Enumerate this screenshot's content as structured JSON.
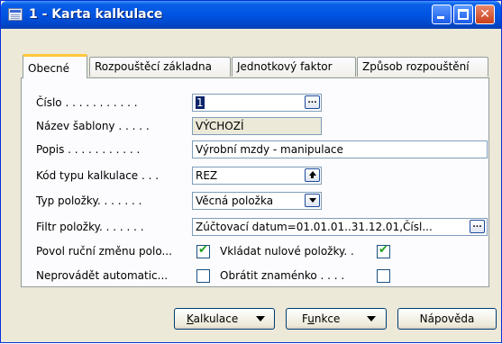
{
  "window": {
    "title": "1 - Karta kalkulace",
    "close_glyph": "✕"
  },
  "tabs": [
    "Obecné",
    "Rozpouštěcí základna",
    "Jednotkový faktor",
    "Způsob rozpouštění"
  ],
  "fields": {
    "cislo": {
      "label": "Číslo . . . . . . . . . . .",
      "value": "1"
    },
    "nazev_sablony": {
      "label": "Název šablony . . . . .",
      "value": "VÝCHOZÍ"
    },
    "popis": {
      "label": "Popis . . . . . . . . . . .",
      "value": "Výrobní mzdy - manipulace"
    },
    "kod_typu": {
      "label": "Kód typu kalkulace . . .",
      "value": "REZ"
    },
    "typ_polozky": {
      "label": "Typ položky. . . . . . .",
      "value": "Věcná položka"
    },
    "filtr_polozky": {
      "label": "Filtr položky. . . . . . .",
      "value": "Zúčtovací datum=01.01.01..31.12.01,Čísl..."
    }
  },
  "checkboxes": {
    "povol_rucni": {
      "label": "Povol ruční změnu polo...",
      "checked": true
    },
    "vkladat_nulove": {
      "label": "Vkládat nulové položky. .",
      "checked": true
    },
    "neprovadet": {
      "label": "Neprovádět automatic...",
      "checked": false
    },
    "obratit": {
      "label": "Obrátit znaménko . . . .",
      "checked": false
    }
  },
  "buttons": {
    "kalkulace": {
      "underline": "K",
      "rest": "alkulace"
    },
    "funkce": {
      "pre": "F",
      "underline": "u",
      "rest": "nkce"
    },
    "napoveda": "Nápověda"
  },
  "icons": {
    "lookup": "...",
    "check": "✔"
  }
}
